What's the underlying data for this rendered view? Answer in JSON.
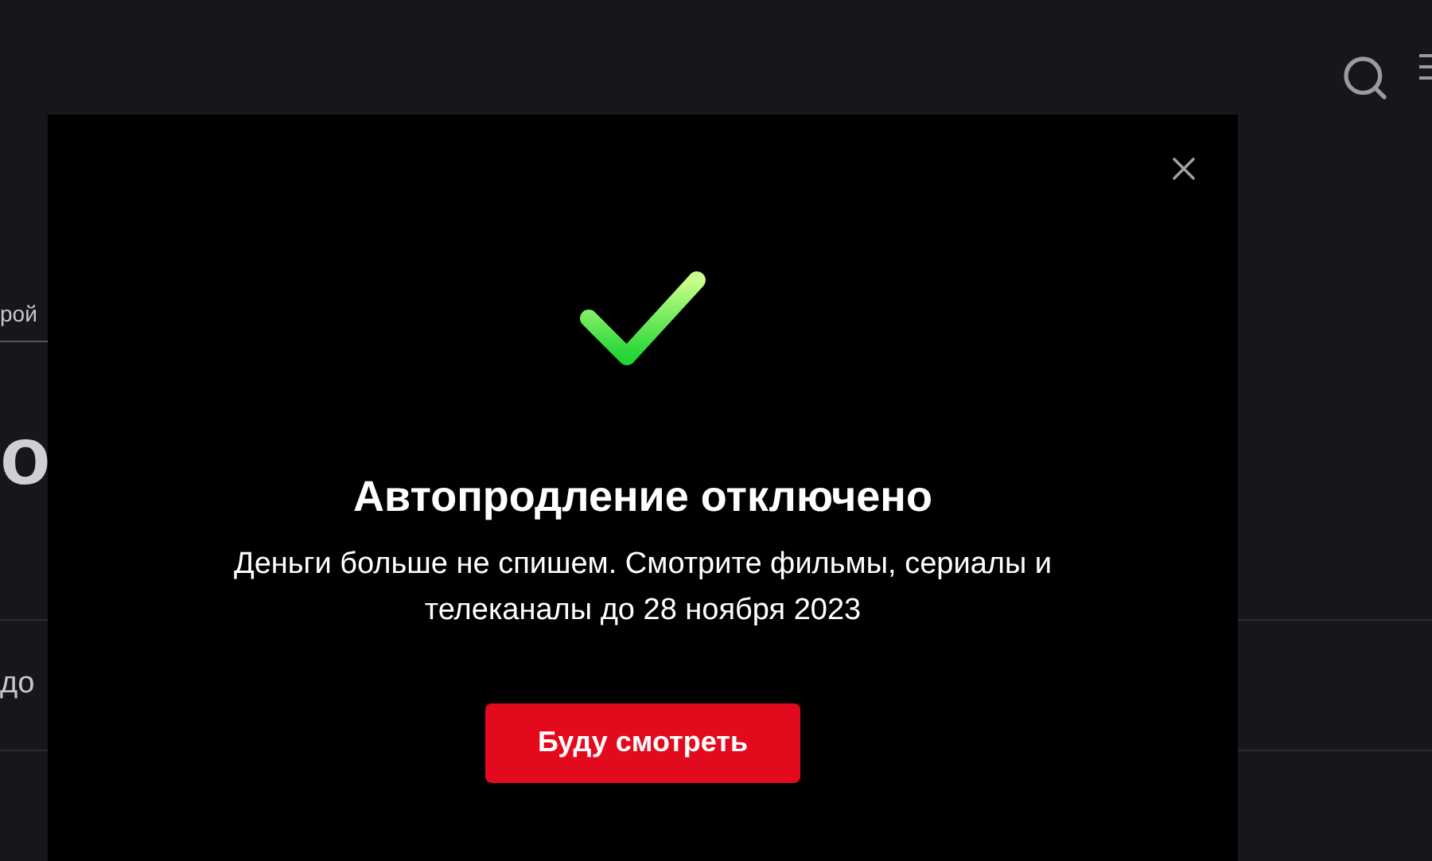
{
  "background": {
    "tab_label": "рой",
    "heading": "о",
    "row_text": "до"
  },
  "dialog": {
    "title": "Автопродление отключено",
    "message": "Деньги больше не спишем. Смотрите фильмы, сериалы и телеканалы до 28 ноября 2023",
    "button": "Буду смотреть"
  }
}
